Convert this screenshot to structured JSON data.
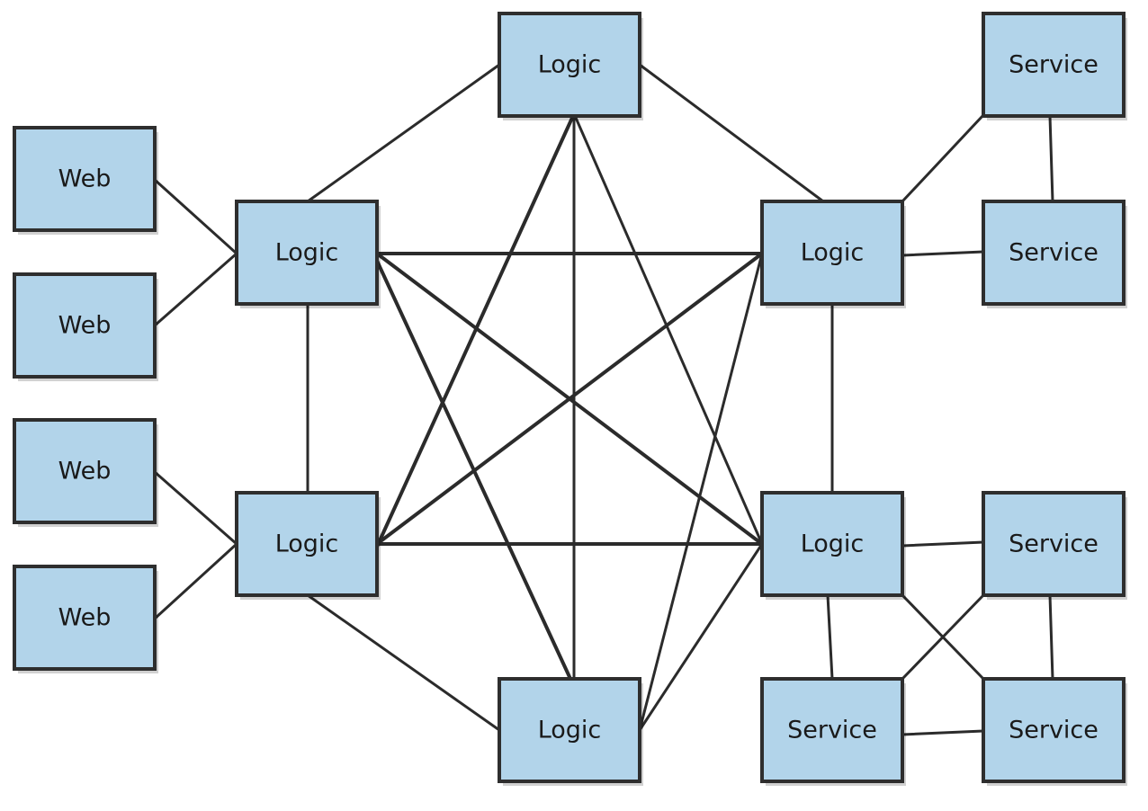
{
  "diagram": {
    "title": "",
    "colors": {
      "node_fill": "#b2d4ea",
      "stroke": "#2b2b2b",
      "background": "#ffffff"
    },
    "nodes": [
      {
        "id": "web1",
        "label": "Web",
        "group": "web"
      },
      {
        "id": "web2",
        "label": "Web",
        "group": "web"
      },
      {
        "id": "web3",
        "label": "Web",
        "group": "web"
      },
      {
        "id": "web4",
        "label": "Web",
        "group": "web"
      },
      {
        "id": "logicTop",
        "label": "Logic",
        "group": "logic"
      },
      {
        "id": "logicUL",
        "label": "Logic",
        "group": "logic"
      },
      {
        "id": "logicUR",
        "label": "Logic",
        "group": "logic"
      },
      {
        "id": "logicLL",
        "label": "Logic",
        "group": "logic"
      },
      {
        "id": "logicLR",
        "label": "Logic",
        "group": "logic"
      },
      {
        "id": "logicBot",
        "label": "Logic",
        "group": "logic"
      },
      {
        "id": "svc1",
        "label": "Service",
        "group": "service"
      },
      {
        "id": "svc2",
        "label": "Service",
        "group": "service"
      },
      {
        "id": "svc3",
        "label": "Service",
        "group": "service"
      },
      {
        "id": "svc4",
        "label": "Service",
        "group": "service"
      },
      {
        "id": "svc5",
        "label": "Service",
        "group": "service"
      }
    ],
    "edges": [
      [
        "web1",
        "logicUL"
      ],
      [
        "web2",
        "logicUL"
      ],
      [
        "web3",
        "logicLL"
      ],
      [
        "web4",
        "logicLL"
      ],
      [
        "logicTop",
        "logicUL"
      ],
      [
        "logicTop",
        "logicUR"
      ],
      [
        "logicTop",
        "logicLL"
      ],
      [
        "logicTop",
        "logicLR"
      ],
      [
        "logicTop",
        "logicBot"
      ],
      [
        "logicUL",
        "logicUR"
      ],
      [
        "logicUL",
        "logicLL"
      ],
      [
        "logicUL",
        "logicLR"
      ],
      [
        "logicUL",
        "logicBot"
      ],
      [
        "logicUR",
        "logicLL"
      ],
      [
        "logicUR",
        "logicLR"
      ],
      [
        "logicUR",
        "logicBot"
      ],
      [
        "logicLL",
        "logicLR"
      ],
      [
        "logicLL",
        "logicBot"
      ],
      [
        "logicLR",
        "logicBot"
      ],
      [
        "logicUR",
        "svc1"
      ],
      [
        "logicUR",
        "svc2"
      ],
      [
        "svc1",
        "svc2"
      ],
      [
        "logicLR",
        "svc3"
      ],
      [
        "logicLR",
        "svc4"
      ],
      [
        "logicLR",
        "svc5"
      ],
      [
        "svc3",
        "svc4"
      ],
      [
        "svc3",
        "svc5"
      ],
      [
        "svc4",
        "svc5"
      ]
    ]
  }
}
